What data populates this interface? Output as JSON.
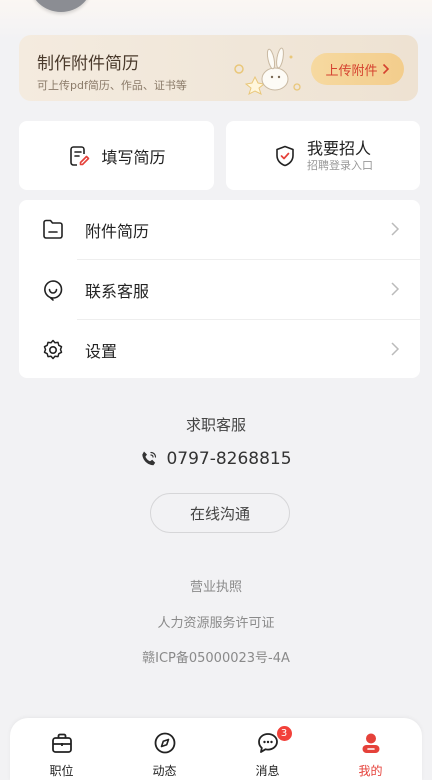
{
  "colors": {
    "accent": "#e5413a",
    "background": "#f2f2f4",
    "banner_button": "#f3cd8c"
  },
  "banner": {
    "title": "制作附件简历",
    "subtitle": "可上传pdf简历、作品、证书等",
    "button_label": "上传附件"
  },
  "quick_actions": {
    "fill_resume": {
      "label": "填写简历",
      "icon": "edit-document-icon"
    },
    "recruit": {
      "title": "我要招人",
      "subtitle": "招聘登录入口",
      "icon": "shield-check-icon"
    }
  },
  "menu": {
    "items": [
      {
        "label": "附件简历",
        "icon": "folder-icon"
      },
      {
        "label": "联系客服",
        "icon": "chat-heart-icon"
      },
      {
        "label": "设置",
        "icon": "gear-icon"
      }
    ]
  },
  "service": {
    "title": "求职客服",
    "phone": "0797-8268815",
    "online_button": "在线沟通"
  },
  "footer": {
    "license": "营业执照",
    "hr_permit": "人力资源服务许可证",
    "icp": "赣ICP备05000023号-4A"
  },
  "tabbar": {
    "tabs": [
      {
        "label": "职位",
        "icon": "briefcase-icon"
      },
      {
        "label": "动态",
        "icon": "compass-icon"
      },
      {
        "label": "消息",
        "icon": "message-icon",
        "badge": "3"
      },
      {
        "label": "我的",
        "icon": "profile-icon",
        "active": true
      }
    ]
  }
}
